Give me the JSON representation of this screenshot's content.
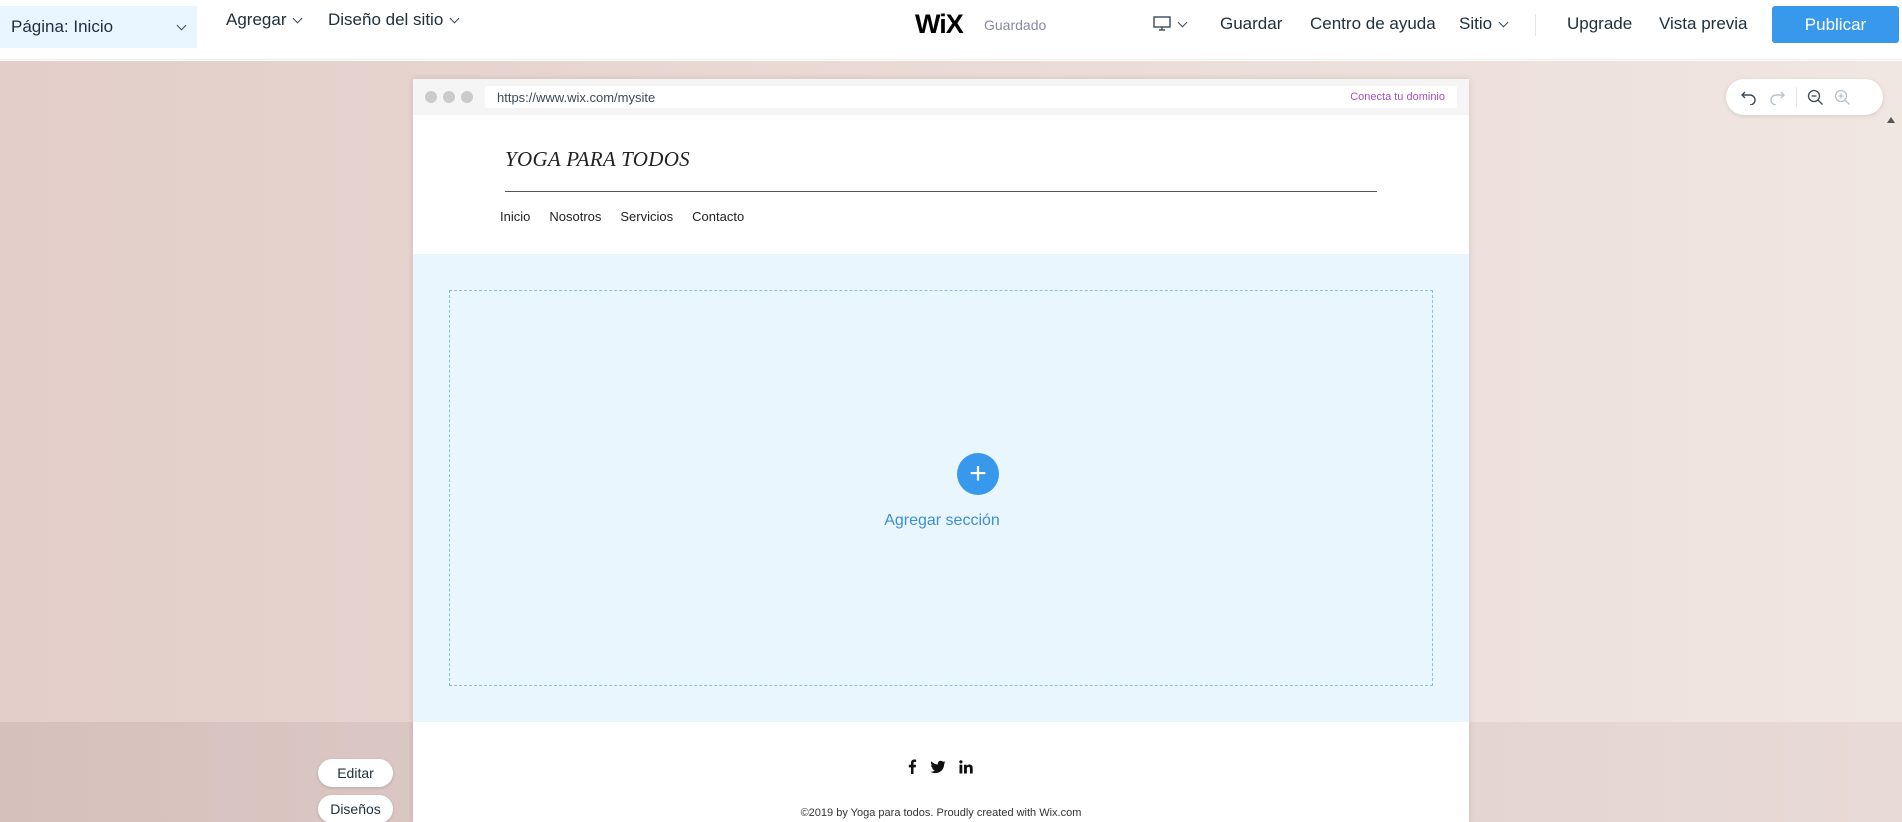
{
  "topbar": {
    "page_select": "Página: Inicio",
    "add": "Agregar",
    "site_design": "Diseño del sitio",
    "logo": "WiX",
    "saved_status": "Guardado",
    "save": "Guardar",
    "help_center": "Centro de ayuda",
    "site": "Sitio",
    "upgrade": "Upgrade",
    "preview": "Vista previa",
    "publish": "Publicar"
  },
  "browser": {
    "url": "https://www.wix.com/mysite",
    "connect_domain": "Conecta tu dominio"
  },
  "site": {
    "title": "YOGA PARA TODOS",
    "nav": [
      "Inicio",
      "Nosotros",
      "Servicios",
      "Contacto"
    ],
    "add_section": "Agregar sección",
    "add_icon": "+",
    "copyright": "©2019 by Yoga para todos. Proudly created with Wix.com"
  },
  "side_buttons": {
    "edit": "Editar",
    "designs": "Diseños"
  },
  "colors": {
    "accent": "#3899ec",
    "section_bg": "#eaf6fd",
    "domain_link": "#aa4dc8"
  },
  "icons": [
    "chevron-down-icon",
    "desktop-icon",
    "undo-icon",
    "redo-icon",
    "zoom-out-icon",
    "zoom-in-icon",
    "facebook-icon",
    "twitter-icon",
    "linkedin-icon",
    "plus-icon"
  ]
}
